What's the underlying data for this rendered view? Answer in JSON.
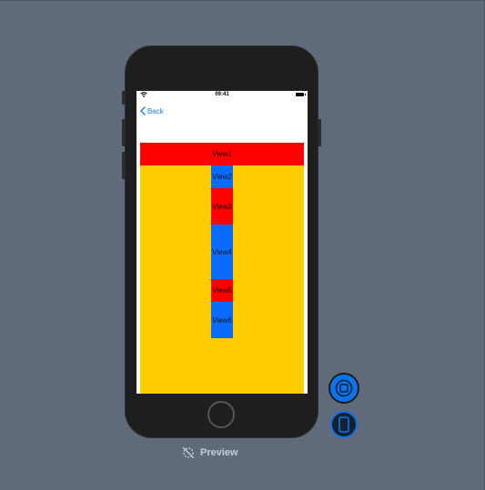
{
  "status_bar": {
    "time": "09:41"
  },
  "nav": {
    "back_label": "Back"
  },
  "views": {
    "view1": "View1",
    "view2": "View2",
    "view3": "View3",
    "view4": "View4",
    "view5": "View5",
    "view6": "View6"
  },
  "preview": {
    "label": "Preview",
    "icon": "preview-disabled-icon"
  },
  "controls": {
    "live_button_icon": "live-preview-icon",
    "device_button_icon": "device-preview-icon"
  },
  "colors": {
    "canvas": "#5f6b7a",
    "phone": "#1e1e1e",
    "container": "#ffcc00",
    "red": "#ff0000",
    "blue": "#0a6cff",
    "accent": "#1a7cf0"
  }
}
